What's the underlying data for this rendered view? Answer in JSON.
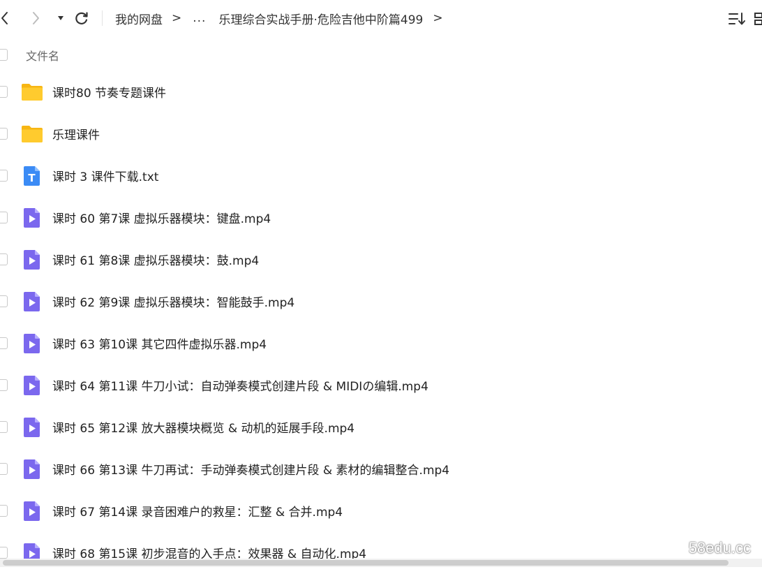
{
  "toolbar": {
    "icons": {
      "back": "chevron-left-icon",
      "forward": "chevron-right-icon",
      "history": "caret-down-icon",
      "refresh": "refresh-icon",
      "sort": "sort-descending-icon",
      "view": "view-mode-icon"
    },
    "breadcrumb": {
      "root": "我的网盘",
      "sep1": ">",
      "ellipsis": "...",
      "current": "乐理综合实战手册·危险吉他中阶篇499",
      "sep2": ">"
    }
  },
  "header": {
    "name_label": "文件名"
  },
  "files": [
    {
      "name": "课时80 节奏专题课件",
      "icon": "folder-icon"
    },
    {
      "name": "乐理课件",
      "icon": "folder-icon"
    },
    {
      "name": "课时 3  课件下载.txt",
      "icon": "text-file-icon",
      "badge": "T"
    },
    {
      "name": "课时 60  第7课 虚拟乐器模块：键盘.mp4",
      "icon": "video-file-icon"
    },
    {
      "name": "课时 61  第8课 虚拟乐器模块：鼓.mp4",
      "icon": "video-file-icon"
    },
    {
      "name": "课时 62  第9课 虚拟乐器模块：智能鼓手.mp4",
      "icon": "video-file-icon"
    },
    {
      "name": "课时 63  第10课 其它四件虚拟乐器.mp4",
      "icon": "video-file-icon"
    },
    {
      "name": "课时 64  第11课 牛刀小试：自动弹奏模式创建片段 & MIDIの编辑.mp4",
      "icon": "video-file-icon"
    },
    {
      "name": "课时 65  第12课 放大器模块概览 & 动机的延展手段.mp4",
      "icon": "video-file-icon"
    },
    {
      "name": "课时 66  第13课 牛刀再试：手动弹奏模式创建片段 & 素材的编辑整合.mp4",
      "icon": "video-file-icon"
    },
    {
      "name": "课时 67  第14课 录音困难户的救星：汇整 & 合并.mp4",
      "icon": "video-file-icon"
    },
    {
      "name": "课时 68  第15课 初步混音的入手点：效果器 & 自动化.mp4",
      "icon": "video-file-icon"
    }
  ],
  "watermark": "58edu.cc",
  "colors": {
    "folder": "#FFCB2E",
    "text_file": "#3B8BF5",
    "video_file": "#7B68EE",
    "text": "#222222",
    "muted": "#666666"
  }
}
